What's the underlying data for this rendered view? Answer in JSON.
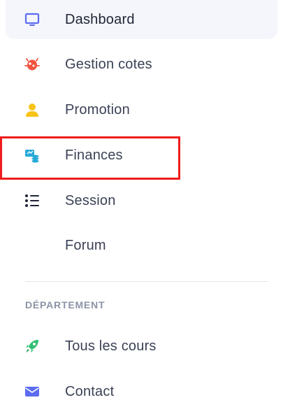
{
  "sidebar": {
    "items": [
      {
        "label": "Dashboard",
        "icon": "monitor-icon"
      },
      {
        "label": "Gestion cotes",
        "icon": "bug-icon"
      },
      {
        "label": "Promotion",
        "icon": "user-icon"
      },
      {
        "label": "Finances",
        "icon": "finance-icon"
      },
      {
        "label": "Session",
        "icon": "list-icon"
      },
      {
        "label": "Forum",
        "icon": ""
      }
    ],
    "section_title": "DÉPARTEMENT",
    "section_items": [
      {
        "label": "Tous les cours",
        "icon": "rocket-icon"
      },
      {
        "label": "Contact",
        "icon": "envelope-icon"
      }
    ]
  },
  "colors": {
    "active_bg": "#f4f6fb",
    "highlight_border": "#ee1c1c",
    "dashboard_icon": "#5b6cf2",
    "gestion_icon": "#f0533d",
    "promotion_icon": "#f7c318",
    "finances_icon": "#27a9d8",
    "session_icon": "#1e2435",
    "tous_icon": "#2fbf71",
    "contact_icon": "#5b6cf2"
  }
}
